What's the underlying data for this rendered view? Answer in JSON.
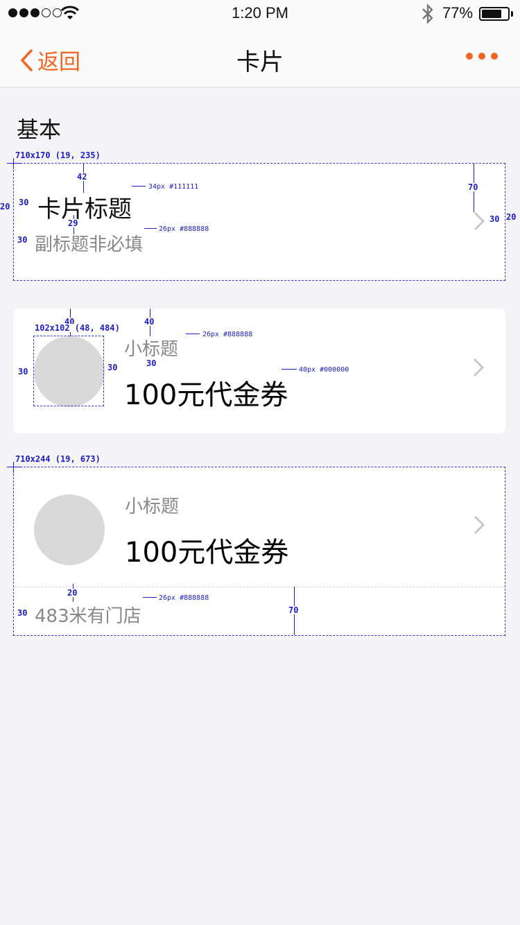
{
  "status_bar": {
    "time": "1:20 PM",
    "battery_percent": "77%",
    "battery_level": 0.77,
    "signal_bars_filled": 3,
    "signal_bars_total": 5
  },
  "nav": {
    "back_label": "返回",
    "title": "卡片",
    "accent_color": "#f26522"
  },
  "section": {
    "title": "基本"
  },
  "cards": {
    "card1": {
      "title": "卡片标题",
      "subtitle": "副标题非必填"
    },
    "card2": {
      "small_title": "小标题",
      "big_title": "100元代金券"
    },
    "card3": {
      "small_title": "小标题",
      "big_title": "100元代金券",
      "footer": "483米有门店"
    }
  },
  "annotations": {
    "card1_box": "710x170 (19, 235)",
    "card1_top": "42",
    "card1_title_spec": "34px #111111",
    "card1_left": "30",
    "card1_left_edge": "20",
    "card1_gap": "29",
    "card1_sub_spec": "26px #888888",
    "card1_sub_left": "30",
    "card1_right_height": "70",
    "card1_right": "30",
    "card1_right_edge": "20",
    "card2_top_left": "40",
    "card2_top_right": "40",
    "card2_thumb_box": "102x102 (48, 484)",
    "card2_small_spec": "26px #888888",
    "card2_left": "30",
    "card2_thumb_right": "30",
    "card2_gap": "30",
    "card2_big_spec": "40px #000000",
    "card3_box": "710x244 (19, 673)",
    "card3_footer_gap": "20",
    "card3_footer_spec": "26px #888888",
    "card3_footer_left": "30",
    "card3_footer_height": "70"
  }
}
